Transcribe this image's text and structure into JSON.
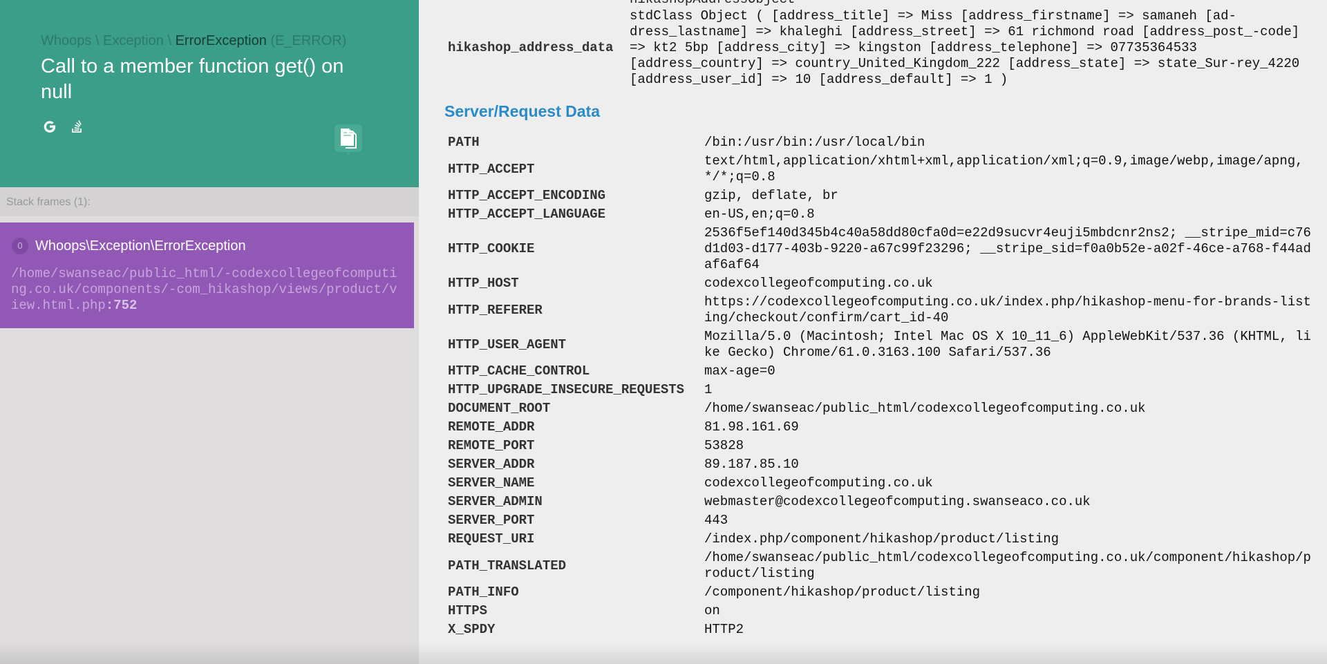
{
  "exception": {
    "breadcrumb": {
      "part1": "Whoops",
      "sep1": " \\ ",
      "part2": "Exception",
      "sep2": " \\ ",
      "part3": "ErrorException",
      "code": " (E_ERROR)"
    },
    "message": "Call to a member function get() on null",
    "icons": [
      "google-search-icon",
      "stackoverflow-icon",
      "copy-clipboard-icon"
    ]
  },
  "frames": {
    "header": "Stack frames (1):",
    "items": [
      {
        "index": "0",
        "class": "Whoops\\Exception\\ErrorException",
        "file": "/home/swanseac/public_html/-codexcollegeofcomputing.co.uk/components/-com_hikashop/views/product/view.html.php",
        "line": ":752"
      }
    ]
  },
  "address": {
    "truncated_above": "hikashopAddressObject",
    "key": "hikashop_address_data",
    "value": "stdClass Object ( [address_title] => Miss [address_firstname] => samaneh [ad-dress_lastname] => khaleghi [address_street] => 61 richmond road [address_post_-code] => kt2 5bp [address_city] => kingston [address_telephone] => 07735364533 [address_country] => country_United_Kingdom_222 [address_state] => state_Sur-rey_4220 [address_user_id] => 10 [address_default] => 1 )"
  },
  "server_section": {
    "title": "Server/Request Data",
    "rows": [
      {
        "key": "PATH",
        "value": "/bin:/usr/bin:/usr/local/bin"
      },
      {
        "key": "HTTP_ACCEPT",
        "value": "text/html,application/xhtml+xml,application/xml;q=0.9,image/webp,image/apng,*/*;q=0.8"
      },
      {
        "key": "HTTP_ACCEPT_ENCODING",
        "value": "gzip, deflate, br"
      },
      {
        "key": "HTTP_ACCEPT_LANGUAGE",
        "value": "en-US,en;q=0.8"
      },
      {
        "key": "HTTP_COOKIE",
        "value": "2536f5ef140d345b4c40a58dd80cfa0d=e22d9sucvr4euji5mbdcnr2ns2; __stripe_mid=c76d1d03-d177-403b-9220-a67c99f23296; __stripe_sid=f0a0b52e-a02f-46ce-a768-f44adaf6af64"
      },
      {
        "key": "HTTP_HOST",
        "value": "codexcollegeofcomputing.co.uk"
      },
      {
        "key": "HTTP_REFERER",
        "value": "https://codexcollegeofcomputing.co.uk/index.php/hikashop-menu-for-brands-listing/checkout/confirm/cart_id-40"
      },
      {
        "key": "HTTP_USER_AGENT",
        "value": "Mozilla/5.0 (Macintosh; Intel Mac OS X 10_11_6) AppleWebKit/537.36 (KHTML, like Gecko) Chrome/61.0.3163.100 Safari/537.36"
      },
      {
        "key": "HTTP_CACHE_CONTROL",
        "value": "max-age=0"
      },
      {
        "key": "HTTP_UPGRADE_INSECURE_REQUESTS",
        "value": "1"
      },
      {
        "key": "DOCUMENT_ROOT",
        "value": "/home/swanseac/public_html/codexcollegeofcomputing.co.uk"
      },
      {
        "key": "REMOTE_ADDR",
        "value": "81.98.161.69"
      },
      {
        "key": "REMOTE_PORT",
        "value": "53828"
      },
      {
        "key": "SERVER_ADDR",
        "value": "89.187.85.10"
      },
      {
        "key": "SERVER_NAME",
        "value": "codexcollegeofcomputing.co.uk"
      },
      {
        "key": "SERVER_ADMIN",
        "value": "webmaster@codexcollegeofcomputing.swanseaco.co.uk"
      },
      {
        "key": "SERVER_PORT",
        "value": "443"
      },
      {
        "key": "REQUEST_URI",
        "value": "/index.php/component/hikashop/product/listing"
      },
      {
        "key": "PATH_TRANSLATED",
        "value": "/home/swanseac/public_html/codexcollegeofcomputing.co.uk/component/hikashop/product/listing"
      },
      {
        "key": "PATH_INFO",
        "value": "/component/hikashop/product/listing"
      },
      {
        "key": "HTTPS",
        "value": "on"
      },
      {
        "key": "X_SPDY",
        "value": "HTTP2"
      }
    ]
  },
  "colors": {
    "header_bg": "#3a9e88",
    "frame_active_bg": "#9159b5",
    "section_title": "#2a8bc9",
    "left_bg": "#dedcdc",
    "right_bg": "#eeeeee"
  }
}
